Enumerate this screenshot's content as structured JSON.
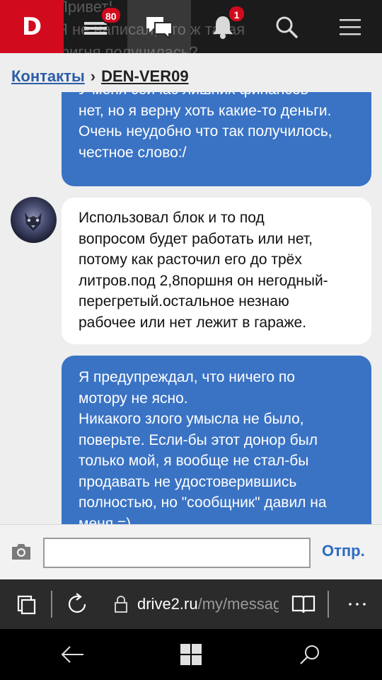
{
  "header": {
    "logo": "D",
    "background_text": [
      "Привет!",
      "Я не написал, что ж такая",
      "фигня получилась?"
    ],
    "feed_badge": "80",
    "notifications_badge": "1"
  },
  "breadcrumb": {
    "contacts": "Контакты",
    "separator": "›",
    "current": "DEN-VER09"
  },
  "messages": [
    {
      "direction": "outgoing",
      "lines": [
        "У меня сейчас лишних финансов",
        "нет, но я верну хоть какие-то деньги.",
        "Очень неудобно что так получилось,",
        "честное слово:/"
      ]
    },
    {
      "direction": "incoming",
      "lines": [
        "Использовал блок и то под",
        "вопросом будет работать или нет,",
        "потому как расточил его до трёх",
        "литров.под 2,8поршня он негодный-",
        "перегретый.остальное незнаю",
        "рабочее или нет лежит в гараже."
      ]
    },
    {
      "direction": "outgoing",
      "lines": [
        "Я предупреждал, что ничего по",
        "мотору не ясно.",
        "Никакого злого умысла не было,",
        "поверьте. Если-бы этот донор был",
        "только мой, я вообще не стал-бы",
        "продавать не удостоверившись",
        "полностью, но \"сообщник\" давил на",
        "меня =)"
      ]
    }
  ],
  "composer": {
    "input_value": "",
    "send_label": "Отпр."
  },
  "browser": {
    "url_domain": "drive2.ru",
    "url_path": "/my/messag"
  },
  "colors": {
    "brand_red": "#d20a1e",
    "outgoing_bubble": "#3a73c4",
    "link_blue": "#2c5ea8"
  }
}
